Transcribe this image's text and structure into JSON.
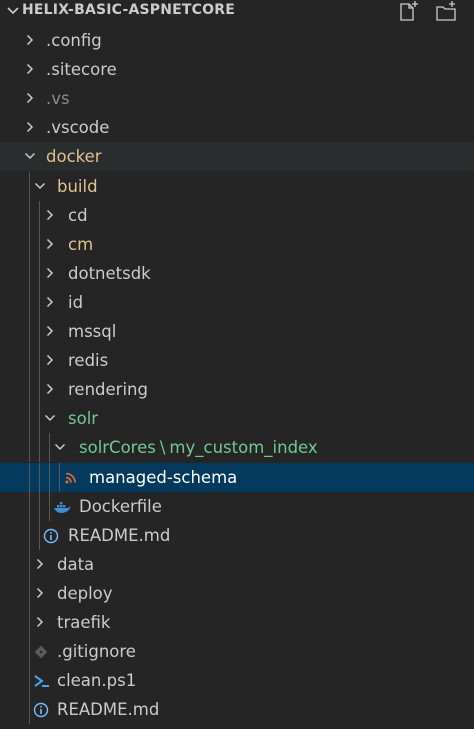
{
  "header": {
    "title": "HELIX-BASIC-ASPNETCORE"
  },
  "tree": [
    {
      "label": ".config",
      "depth": 0,
      "kind": "folder",
      "expanded": false,
      "color": "#cccccc"
    },
    {
      "label": ".sitecore",
      "depth": 0,
      "kind": "folder",
      "expanded": false,
      "color": "#cccccc"
    },
    {
      "label": ".vs",
      "depth": 0,
      "kind": "folder",
      "expanded": false,
      "color": "#8b8b8b"
    },
    {
      "label": ".vscode",
      "depth": 0,
      "kind": "folder",
      "expanded": false,
      "color": "#cccccc"
    },
    {
      "label": "docker",
      "depth": 0,
      "kind": "folder",
      "expanded": true,
      "color": "#e2c08d"
    },
    {
      "label": "build",
      "depth": 1,
      "kind": "folder",
      "expanded": true,
      "color": "#e2c08d"
    },
    {
      "label": "cd",
      "depth": 2,
      "kind": "folder",
      "expanded": false,
      "color": "#cccccc"
    },
    {
      "label": "cm",
      "depth": 2,
      "kind": "folder",
      "expanded": false,
      "color": "#e2c08d"
    },
    {
      "label": "dotnetsdk",
      "depth": 2,
      "kind": "folder",
      "expanded": false,
      "color": "#cccccc"
    },
    {
      "label": "id",
      "depth": 2,
      "kind": "folder",
      "expanded": false,
      "color": "#cccccc"
    },
    {
      "label": "mssql",
      "depth": 2,
      "kind": "folder",
      "expanded": false,
      "color": "#cccccc"
    },
    {
      "label": "redis",
      "depth": 2,
      "kind": "folder",
      "expanded": false,
      "color": "#cccccc"
    },
    {
      "label": "rendering",
      "depth": 2,
      "kind": "folder",
      "expanded": false,
      "color": "#cccccc"
    },
    {
      "label": "solr",
      "depth": 2,
      "kind": "folder",
      "expanded": true,
      "color": "#73c991"
    },
    {
      "label": "solrCores",
      "label2": "my_custom_index",
      "separator": "\\",
      "depth": 3,
      "kind": "folder",
      "expanded": true,
      "color": "#73c991"
    },
    {
      "label": "managed-schema",
      "depth": 4,
      "kind": "file",
      "icon": "rss-icon",
      "color": "#ffffff",
      "selected": true
    },
    {
      "label": "Dockerfile",
      "depth": 3,
      "kind": "file",
      "icon": "docker-icon",
      "color": "#cccccc"
    },
    {
      "label": "README.md",
      "depth": 2,
      "kind": "file",
      "icon": "info-icon",
      "color": "#cccccc"
    },
    {
      "label": "data",
      "depth": 1,
      "kind": "folder",
      "expanded": false,
      "color": "#cccccc"
    },
    {
      "label": "deploy",
      "depth": 1,
      "kind": "folder",
      "expanded": false,
      "color": "#cccccc"
    },
    {
      "label": "traefik",
      "depth": 1,
      "kind": "folder",
      "expanded": false,
      "color": "#cccccc"
    },
    {
      "label": ".gitignore",
      "depth": 1,
      "kind": "file",
      "icon": "git-icon",
      "color": "#cccccc"
    },
    {
      "label": "clean.ps1",
      "depth": 1,
      "kind": "file",
      "icon": "powershell-icon",
      "color": "#cccccc"
    },
    {
      "label": "README.md",
      "depth": 1,
      "kind": "file",
      "icon": "info-icon",
      "color": "#cccccc"
    }
  ]
}
